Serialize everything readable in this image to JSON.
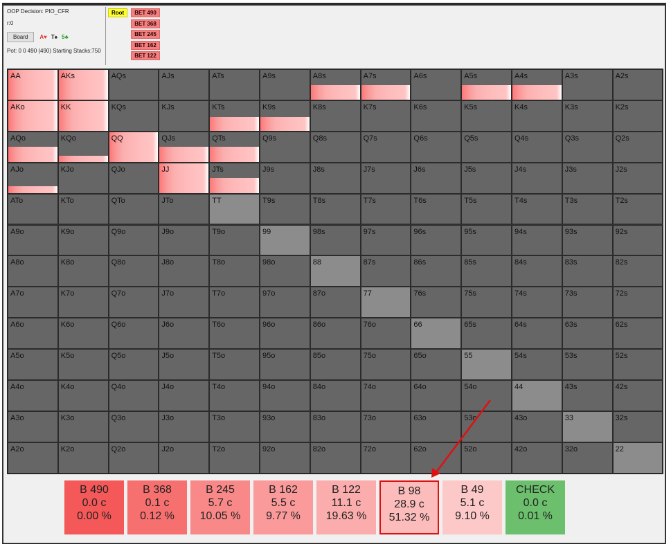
{
  "info": {
    "decision": "OOP Decision:  PIO_CFR",
    "r": "r:0",
    "board_button": "Board",
    "board_cards": [
      {
        "text": "A♥",
        "color": "#e03030"
      },
      {
        "text": "T♠",
        "color": "#111111"
      },
      {
        "text": "5♣",
        "color": "#2a9a2a"
      }
    ],
    "pot": "Pot: 0 0 490 (490) Starting Stacks:750"
  },
  "tree": {
    "root": "Root",
    "bets": [
      "BET 490",
      "BET 368",
      "BET 245",
      "BET 162",
      "BET 122"
    ]
  },
  "grid": {
    "rows": [
      [
        "AA",
        "AKs",
        "AQs",
        "AJs",
        "ATs",
        "A9s",
        "A8s",
        "A7s",
        "A6s",
        "A5s",
        "A4s",
        "A3s",
        "A2s"
      ],
      [
        "AKo",
        "KK",
        "KQs",
        "KJs",
        "KTs",
        "K9s",
        "K8s",
        "K7s",
        "K6s",
        "K5s",
        "K4s",
        "K3s",
        "K2s"
      ],
      [
        "AQo",
        "KQo",
        "QQ",
        "QJs",
        "QTs",
        "Q9s",
        "Q8s",
        "Q7s",
        "Q6s",
        "Q5s",
        "Q4s",
        "Q3s",
        "Q2s"
      ],
      [
        "AJo",
        "KJo",
        "QJo",
        "JJ",
        "JTs",
        "J9s",
        "J8s",
        "J7s",
        "J6s",
        "J5s",
        "J4s",
        "J3s",
        "J2s"
      ],
      [
        "ATo",
        "KTo",
        "QTo",
        "JTo",
        "TT",
        "T9s",
        "T8s",
        "T7s",
        "T6s",
        "T5s",
        "T4s",
        "T3s",
        "T2s"
      ],
      [
        "A9o",
        "K9o",
        "Q9o",
        "J9o",
        "T9o",
        "99",
        "98s",
        "97s",
        "96s",
        "95s",
        "94s",
        "93s",
        "92s"
      ],
      [
        "A8o",
        "K8o",
        "Q8o",
        "J8o",
        "T8o",
        "98o",
        "88",
        "87s",
        "86s",
        "85s",
        "84s",
        "83s",
        "82s"
      ],
      [
        "A7o",
        "K7o",
        "Q7o",
        "J7o",
        "T7o",
        "97o",
        "87o",
        "77",
        "76s",
        "75s",
        "74s",
        "73s",
        "72s"
      ],
      [
        "A6o",
        "K6o",
        "Q6o",
        "J6o",
        "T6o",
        "96o",
        "86o",
        "76o",
        "66",
        "65s",
        "64s",
        "63s",
        "62s"
      ],
      [
        "A5o",
        "K5o",
        "Q5o",
        "J5o",
        "T5o",
        "95o",
        "85o",
        "75o",
        "65o",
        "55",
        "54s",
        "53s",
        "52s"
      ],
      [
        "A4o",
        "K4o",
        "Q4o",
        "J4o",
        "T4o",
        "94o",
        "84o",
        "74o",
        "64o",
        "54o",
        "44",
        "43s",
        "42s"
      ],
      [
        "A3o",
        "K3o",
        "Q3o",
        "J3o",
        "T3o",
        "93o",
        "83o",
        "73o",
        "63o",
        "53o",
        "43o",
        "33",
        "32s"
      ],
      [
        "A2o",
        "K2o",
        "Q2o",
        "J2o",
        "T2o",
        "92o",
        "82o",
        "72o",
        "62o",
        "52o",
        "42o",
        "32o",
        "22"
      ]
    ],
    "bet_frequency": {
      "AA": 1,
      "AKs": 1,
      "AKo": 1,
      "KK": 1,
      "QQ": 1,
      "JJ": 1,
      "KTs": 0.45,
      "K9s": 0.45,
      "AQo": 0.5,
      "KQo": 0.2,
      "QJs": 0.5,
      "QTs": 0.5,
      "AJo": 0.22,
      "JTs": 0.5,
      "A8s": 0.48,
      "A7s": 0.48,
      "A5s": 0.48,
      "A4s": 0.48
    },
    "light_cells": [
      "TT",
      "99",
      "88",
      "77",
      "66",
      "55",
      "44",
      "33",
      "22"
    ]
  },
  "actions": [
    {
      "name": "B 490",
      "ev": "0.0 c",
      "freq": "0.00 %",
      "color": "#f55858"
    },
    {
      "name": "B 368",
      "ev": "0.1 c",
      "freq": "0.12 %",
      "color": "#f77070"
    },
    {
      "name": "B 245",
      "ev": "5.7 c",
      "freq": "10.05 %",
      "color": "#f98888"
    },
    {
      "name": "B 162",
      "ev": "5.5 c",
      "freq": "9.77 %",
      "color": "#fa9a9a"
    },
    {
      "name": "B 122",
      "ev": "11.1 c",
      "freq": "19.63 %",
      "color": "#fbacac"
    },
    {
      "name": "B 98",
      "ev": "28.9 c",
      "freq": "51.32 %",
      "color": "#fcbcbc",
      "selected": true
    },
    {
      "name": "B 49",
      "ev": "5.1 c",
      "freq": "9.10 %",
      "color": "#fdc8c8"
    },
    {
      "name": "CHECK",
      "ev": "0.0 c",
      "freq": "0.01 %",
      "color": "#6cbf6c"
    }
  ]
}
